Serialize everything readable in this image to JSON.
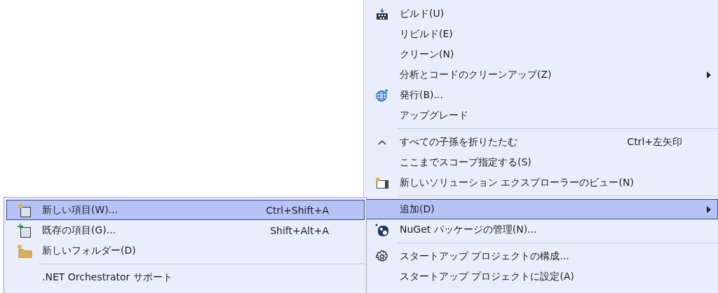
{
  "context_menu": {
    "items": [
      {
        "kind": "item",
        "label": "ビルド(U)",
        "selected": false,
        "has_submenu": false
      },
      {
        "kind": "item",
        "label": "リビルド(E)",
        "selected": false,
        "has_submenu": false
      },
      {
        "kind": "item",
        "label": "クリーン(N)",
        "selected": false,
        "has_submenu": false
      },
      {
        "kind": "item",
        "label": "分析とコードのクリーンアップ(Z)",
        "selected": false,
        "has_submenu": true
      },
      {
        "kind": "item",
        "label": "発行(B)...",
        "selected": false,
        "has_submenu": false
      },
      {
        "kind": "item",
        "label": "アップグレード",
        "selected": false,
        "has_submenu": false
      },
      {
        "kind": "separator"
      },
      {
        "kind": "item",
        "label": "すべての子孫を折りたたむ",
        "shortcut": "Ctrl+左矢印",
        "selected": false,
        "has_submenu": false
      },
      {
        "kind": "item",
        "label": "ここまでスコープ指定する(S)",
        "selected": false,
        "has_submenu": false
      },
      {
        "kind": "item",
        "label": "新しいソリューション エクスプローラーのビュー(N)",
        "selected": false,
        "has_submenu": false
      },
      {
        "kind": "separator"
      },
      {
        "kind": "item",
        "label": "追加(D)",
        "selected": true,
        "has_submenu": true
      },
      {
        "kind": "item",
        "label": "NuGet パッケージの管理(N)...",
        "selected": false,
        "has_submenu": false
      },
      {
        "kind": "separator"
      },
      {
        "kind": "item",
        "label": "スタートアップ プロジェクトの構成...",
        "selected": false,
        "has_submenu": false
      },
      {
        "kind": "item",
        "label": "スタートアップ プロジェクトに設定(A)",
        "selected": false,
        "has_submenu": false
      }
    ]
  },
  "submenu": {
    "items": [
      {
        "kind": "item",
        "label": "新しい項目(W)...",
        "shortcut": "Ctrl+Shift+A",
        "selected": true,
        "has_submenu": false
      },
      {
        "kind": "item",
        "label": "既存の項目(G)...",
        "shortcut": "Shift+Alt+A",
        "selected": false,
        "has_submenu": false
      },
      {
        "kind": "item",
        "label": "新しいフォルダー(D)",
        "selected": false,
        "has_submenu": false
      },
      {
        "kind": "separator"
      },
      {
        "kind": "item",
        "label": ".NET Orchestrator サポート",
        "selected": false,
        "has_submenu": false
      }
    ]
  }
}
